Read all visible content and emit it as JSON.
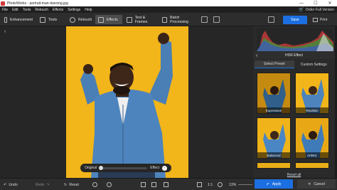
{
  "window": {
    "title": "PhotoWorks - portrait-man-dancing.jpg",
    "minimize": "—",
    "maximize": "☐",
    "close": "✕"
  },
  "menu": {
    "items": [
      "File",
      "Edit",
      "Tools",
      "Retouch",
      "Effects",
      "Settings",
      "Help"
    ],
    "order": "Order Full Version"
  },
  "toolbar": {
    "enhancement": "Enhancement",
    "tools": "Tools",
    "retouch": "Retouch",
    "effects": "Effects",
    "text_frames": "Text & Frames",
    "batch": "Batch Processing",
    "save": "Save",
    "print": "Print"
  },
  "canvas": {
    "compare_left": "Original",
    "compare_right": "Effect",
    "compare_level": 0
  },
  "panel": {
    "title": "HDR Effect",
    "tab_select": "Select Preset",
    "tab_custom": "Custom Settings",
    "presets": [
      "Expressive",
      "Realistic",
      "Balanced",
      "Artistic"
    ],
    "reset_all": "Reset all"
  },
  "bottom": {
    "undo": "Undo",
    "redo": "Redo",
    "reset": "Reset",
    "zoom_fit": "1:1",
    "zoom": "13%",
    "apply": "Apply",
    "cancel": "Cancel"
  },
  "colors": {
    "accent": "#1c6fe0",
    "background": "#f2b51a"
  }
}
